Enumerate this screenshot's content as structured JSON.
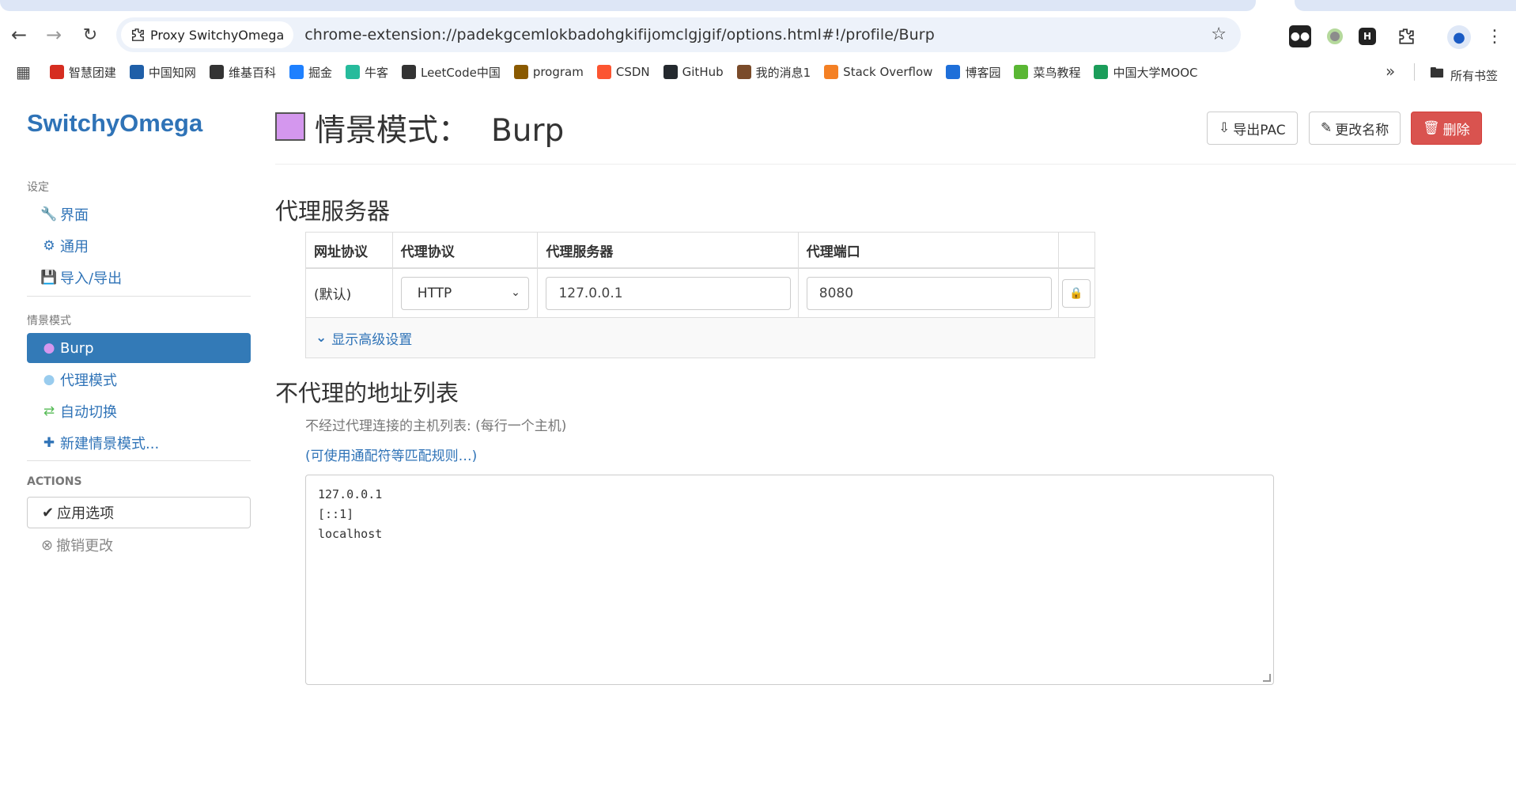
{
  "browser": {
    "tab_chip": "Proxy SwitchyOmega",
    "url": "chrome-extension://padekgcemlokbadohgkifijomclgjgif/options.html#!/profile/Burp",
    "bookmarks": [
      {
        "label": "智慧团建",
        "icon_color": "#d62d20"
      },
      {
        "label": "中国知网",
        "icon_color": "#1f5fa8"
      },
      {
        "label": "维基百科",
        "icon_color": "#333333"
      },
      {
        "label": "掘金",
        "icon_color": "#1e80ff"
      },
      {
        "label": "牛客",
        "icon_color": "#26bb9c"
      },
      {
        "label": "LeetCode中国",
        "icon_color": "#333333"
      },
      {
        "label": "program",
        "icon_color": "#8a5a00"
      },
      {
        "label": "CSDN",
        "icon_color": "#fc5531"
      },
      {
        "label": "GitHub",
        "icon_color": "#24292e"
      },
      {
        "label": "我的消息1",
        "icon_color": "#7a4b2a"
      },
      {
        "label": "Stack Overflow",
        "icon_color": "#f48024"
      },
      {
        "label": "博客园",
        "icon_color": "#1e6fd9"
      },
      {
        "label": "菜鸟教程",
        "icon_color": "#5ab734"
      },
      {
        "label": "中国大学MOOC",
        "icon_color": "#1b9d5a"
      }
    ],
    "all_bookmarks": "所有书签"
  },
  "sidebar": {
    "brand": "SwitchyOmega",
    "settings_header": "设定",
    "settings": [
      {
        "label": "界面",
        "icon": "wrench-icon"
      },
      {
        "label": "通用",
        "icon": "gear-icon"
      },
      {
        "label": "导入/导出",
        "icon": "floppy-icon"
      }
    ],
    "profiles_header": "情景模式",
    "profiles": [
      {
        "label": "Burp",
        "icon": "globe-icon",
        "active": true
      },
      {
        "label": "代理模式",
        "icon": "globe-icon"
      },
      {
        "label": "自动切换",
        "icon": "retweet-icon"
      },
      {
        "label": "新建情景模式...",
        "icon": "plus-icon"
      }
    ],
    "actions_header": "ACTIONS",
    "apply": "应用选项",
    "revert": "撤销更改"
  },
  "header": {
    "title_prefix": "情景模式：",
    "profile_name": "Burp",
    "color": "#d497ee",
    "export_pac": "导出PAC",
    "rename": "更改名称",
    "delete": "删除"
  },
  "proxy_servers": {
    "title": "代理服务器",
    "columns": [
      "网址协议",
      "代理协议",
      "代理服务器",
      "代理端口"
    ],
    "row": {
      "scheme": "(默认)",
      "protocol": "HTTP",
      "server": "127.0.0.1",
      "port": "8080"
    },
    "advanced": "显示高级设置"
  },
  "bypass": {
    "title": "不代理的地址列表",
    "help": "不经过代理连接的主机列表: (每行一个主机)",
    "link": "(可使用通配符等匹配规则…)",
    "entries": [
      "127.0.0.1",
      "[::1]",
      "localhost"
    ]
  }
}
